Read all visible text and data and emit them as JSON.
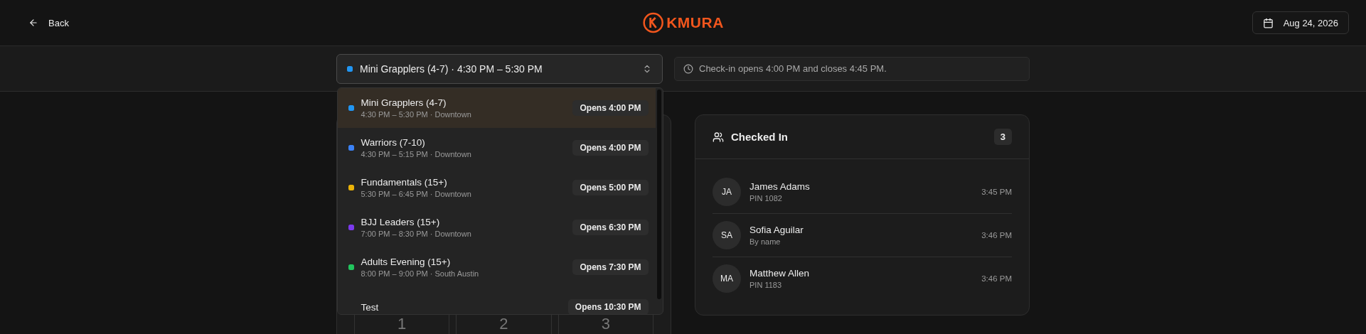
{
  "header": {
    "back": "Back",
    "logo": "KMURA",
    "date": "Aug 24, 2026"
  },
  "class_select": {
    "value": "Mini Grapplers (4-7) · 4:30 PM – 5:30 PM",
    "color": "#2196f3",
    "expanded": true
  },
  "notice": "Check-in opens 4:00 PM and closes 4:45 PM.",
  "class_options": [
    {
      "name": "Mini Grapplers (4-7)",
      "details": "4:30 PM – 5:30 PM · Downtown",
      "opens": "Opens 4:00 PM",
      "color": "#2196f3",
      "selected": true
    },
    {
      "name": "Warriors (7-10)",
      "details": "4:30 PM – 5:15 PM · Downtown",
      "opens": "Opens 4:00 PM",
      "color": "#3b82f6",
      "selected": false
    },
    {
      "name": "Fundamentals (15+)",
      "details": "5:30 PM – 6:45 PM · Downtown",
      "opens": "Opens 5:00 PM",
      "color": "#eab308",
      "selected": false
    },
    {
      "name": "BJJ Leaders (15+)",
      "details": "7:00 PM – 8:30 PM · Downtown",
      "opens": "Opens 6:30 PM",
      "color": "#7c3aed",
      "selected": false
    },
    {
      "name": "Adults Evening (15+)",
      "details": "8:00 PM – 9:00 PM · South Austin",
      "opens": "Opens 7:30 PM",
      "color": "#22c55e",
      "selected": false
    },
    {
      "name": "Test",
      "opens": "Opens 10:30 PM",
      "selected": false
    }
  ],
  "keypad": {
    "keys": [
      "1",
      "2",
      "3"
    ]
  },
  "checked_in": {
    "title": "Checked In",
    "count": "3",
    "people": [
      {
        "initials": "JA",
        "name": "James Adams",
        "method": "PIN 1082",
        "time": "3:45 PM"
      },
      {
        "initials": "SA",
        "name": "Sofia Aguilar",
        "method": "By name",
        "time": "3:46 PM"
      },
      {
        "initials": "MA",
        "name": "Matthew Allen",
        "method": "PIN 1183",
        "time": "3:46 PM"
      }
    ]
  }
}
